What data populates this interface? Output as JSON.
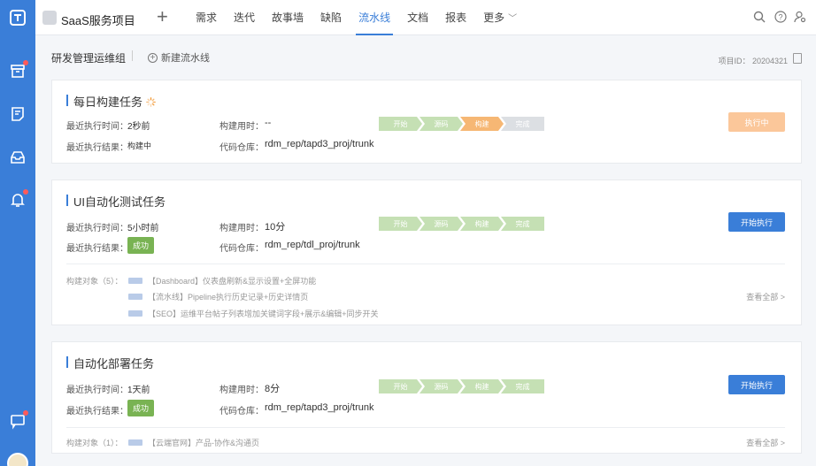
{
  "topbar": {
    "project_name": "SaaS服务项目",
    "nav": [
      "需求",
      "迭代",
      "故事墙",
      "缺陷",
      "流水线",
      "文档",
      "报表",
      "更多"
    ],
    "active_index": 4
  },
  "subheader": {
    "group_name": "研发管理运维组",
    "new_pipeline": "新建流水线",
    "project_id": "项目ID： 20204321"
  },
  "labels": {
    "last_time": "最近执行时间：",
    "last_result": "最近执行结果：",
    "duration": "构建用时：",
    "repo": "代码仓库：",
    "view_all": "查看全部 >"
  },
  "stages": [
    "开始",
    "源码",
    "构建",
    "完成"
  ],
  "cards": [
    {
      "title": "每日构建任务",
      "last_time": "2秒前",
      "duration": "--",
      "result": "构建中",
      "repo": "rdm_rep/tapd3_proj/trunk",
      "button": "执行中",
      "stage_status": [
        "done",
        "done",
        "running",
        "pending"
      ]
    },
    {
      "title": "UI自动化测试任务",
      "last_time": "5小时前",
      "duration": "10分",
      "result": "成功",
      "repo": "rdm_rep/tdl_proj/trunk",
      "button": "开始执行",
      "stage_status": [
        "done",
        "done",
        "done",
        "done"
      ],
      "objects_label": "构建对象（5）：",
      "objects": [
        "【Dashboard】仪表盘刷新&显示设置+全屏功能",
        "【流水线】Pipeline执行历史记录+历史详情页",
        "【SEO】运维平台帖子列表增加关键词字段+展示&编辑+同步开关"
      ]
    },
    {
      "title": "自动化部署任务",
      "last_time": "1天前",
      "duration": "8分",
      "result": "成功",
      "repo": "rdm_rep/tapd3_proj/trunk",
      "button": "开始执行",
      "stage_status": [
        "done",
        "done",
        "done",
        "done"
      ],
      "objects_label": "构建对象（1）：",
      "objects": [
        "【云端官网】产品-协作&沟通页"
      ]
    }
  ],
  "colors": {
    "accent": "#3a7ed8",
    "success": "#79b353",
    "stage_done": "#c5e0b4",
    "stage_running": "#f6b774",
    "stage_pending": "#dcdfe3",
    "btn_disabled": "#fbc79a"
  },
  "icons": {
    "sidebar": [
      "app-logo-icon",
      "archive-icon",
      "notes-icon",
      "inbox-icon",
      "bell-icon",
      "chat-icon"
    ],
    "topbar": [
      "search-icon",
      "help-icon",
      "user-settings-icon"
    ]
  }
}
